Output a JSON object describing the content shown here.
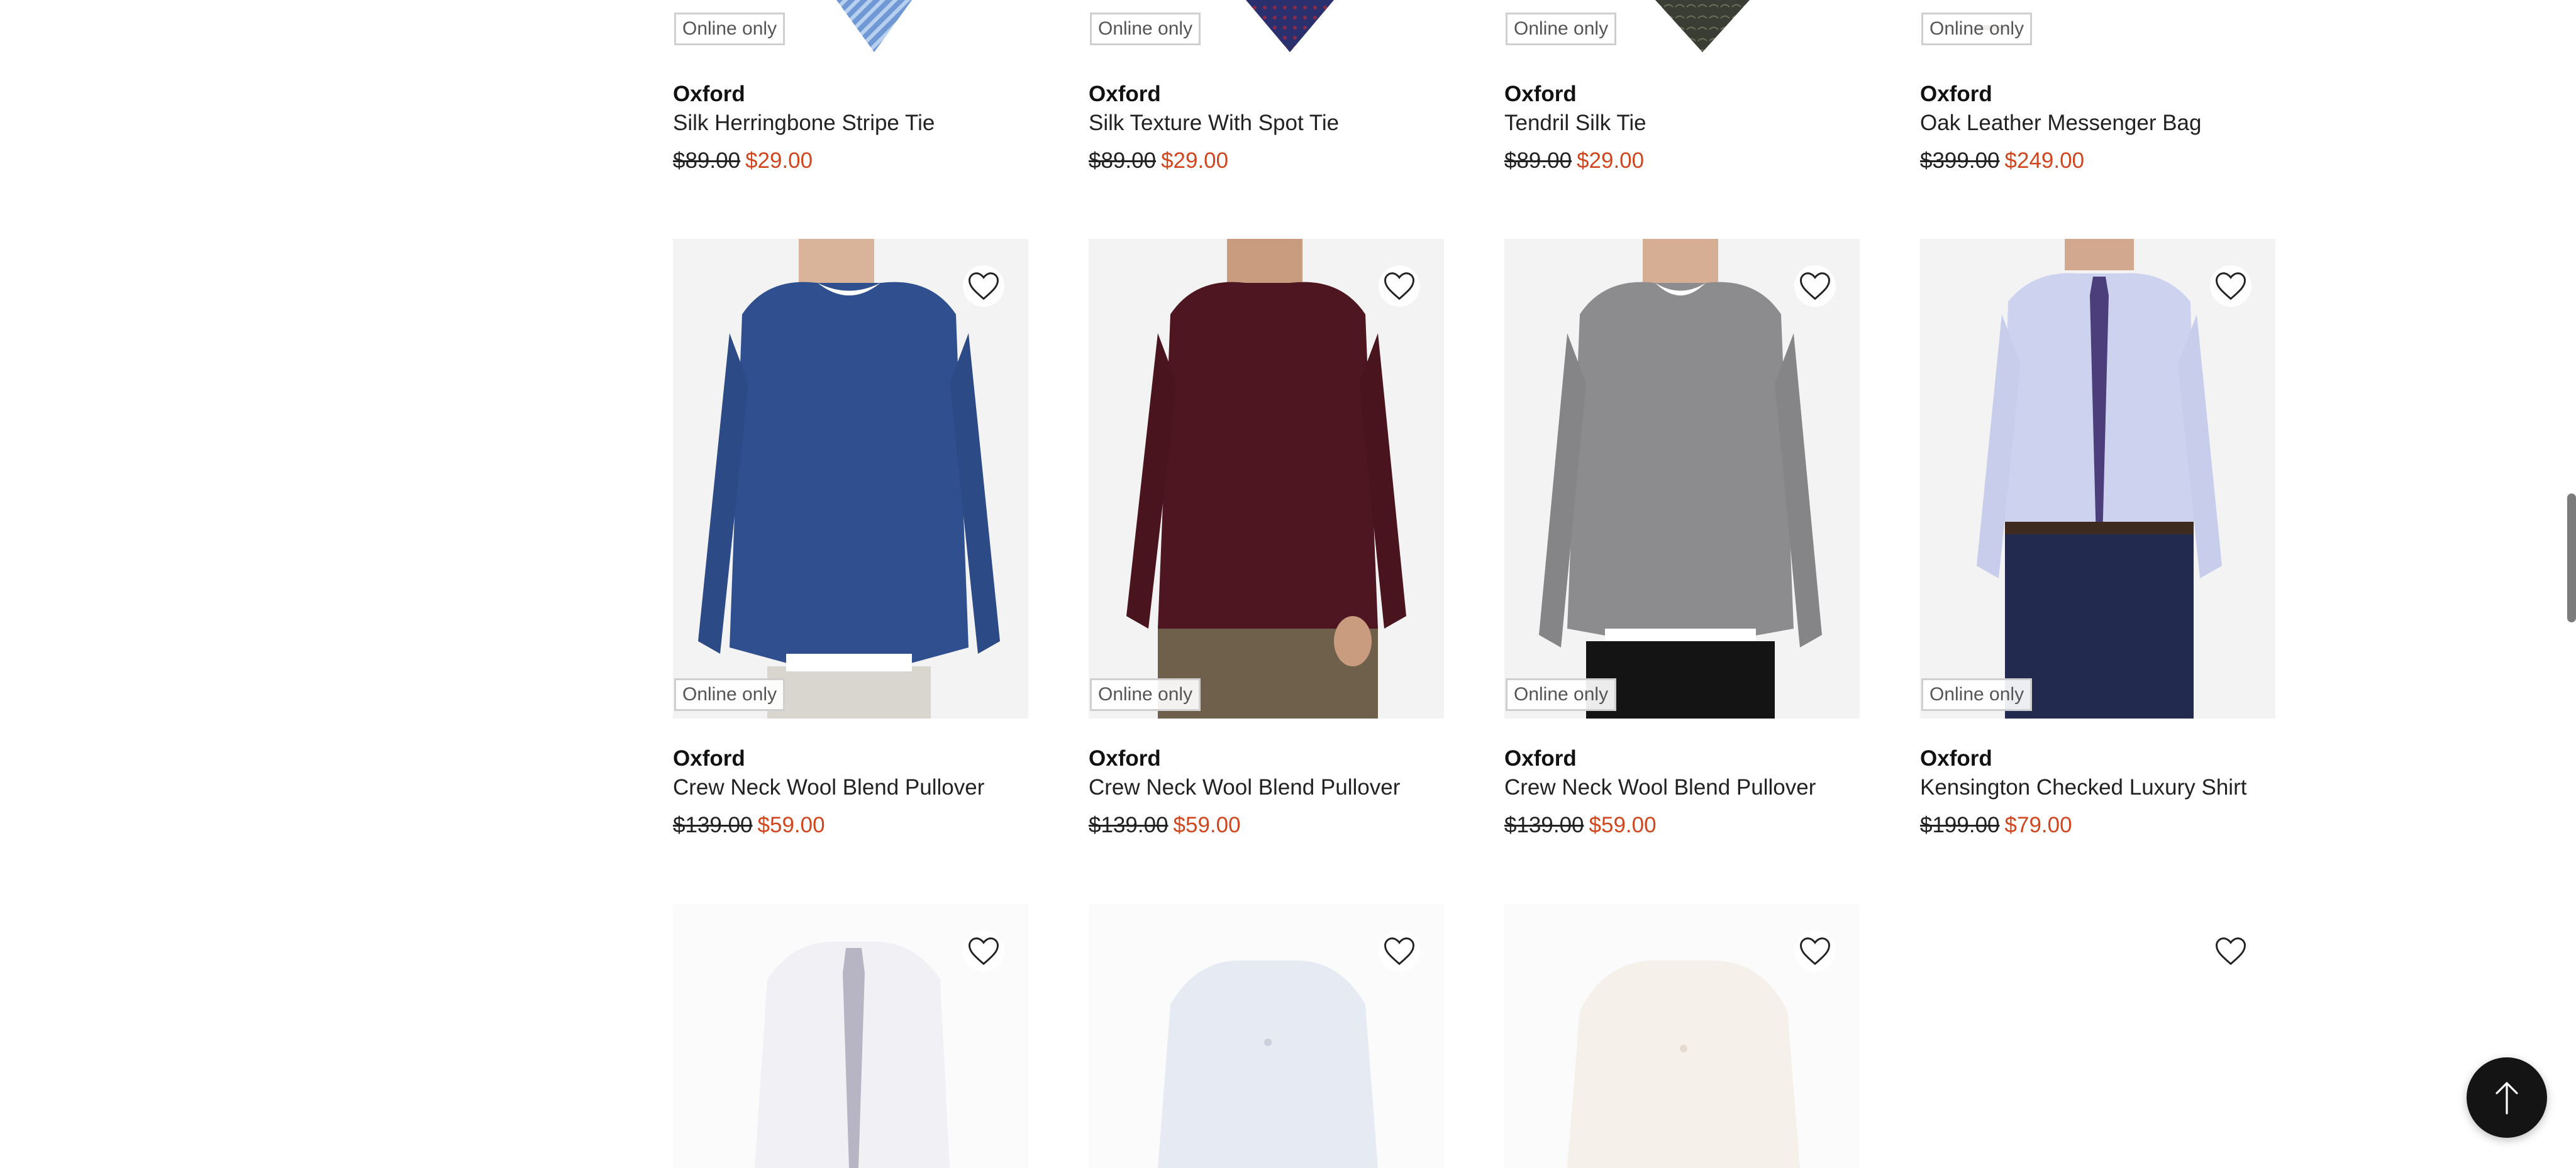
{
  "rows": [
    {
      "products": [
        {
          "badge": "Online only",
          "brand": "Oxford",
          "name": "Silk Herringbone Stripe Tie",
          "was": "$89.00",
          "now": "$29.00"
        },
        {
          "badge": "Online only",
          "brand": "Oxford",
          "name": "Silk Texture With Spot Tie",
          "was": "$89.00",
          "now": "$29.00"
        },
        {
          "badge": "Online only",
          "brand": "Oxford",
          "name": "Tendril Silk Tie",
          "was": "$89.00",
          "now": "$29.00"
        },
        {
          "badge": "Online only",
          "brand": "Oxford",
          "name": "Oak Leather Messenger Bag",
          "was": "$399.00",
          "now": "$249.00"
        }
      ]
    },
    {
      "products": [
        {
          "badge": "Online only",
          "brand": "Oxford",
          "name": "Crew Neck Wool Blend Pullover",
          "was": "$139.00",
          "now": "$59.00"
        },
        {
          "badge": "Online only",
          "brand": "Oxford",
          "name": "Crew Neck Wool Blend Pullover",
          "was": "$139.00",
          "now": "$59.00"
        },
        {
          "badge": "Online only",
          "brand": "Oxford",
          "name": "Crew Neck Wool Blend Pullover",
          "was": "$139.00",
          "now": "$59.00"
        },
        {
          "badge": "Online only",
          "brand": "Oxford",
          "name": "Kensington Checked Luxury Shirt",
          "was": "$199.00",
          "now": "$79.00"
        }
      ]
    }
  ],
  "colors": {
    "sale_price": "#d0461e",
    "badge_border": "#cfcfcf",
    "back_to_top": "#141414"
  },
  "icons": {
    "wishlist": "heart-outline-icon",
    "back_to_top": "arrow-up-icon"
  }
}
